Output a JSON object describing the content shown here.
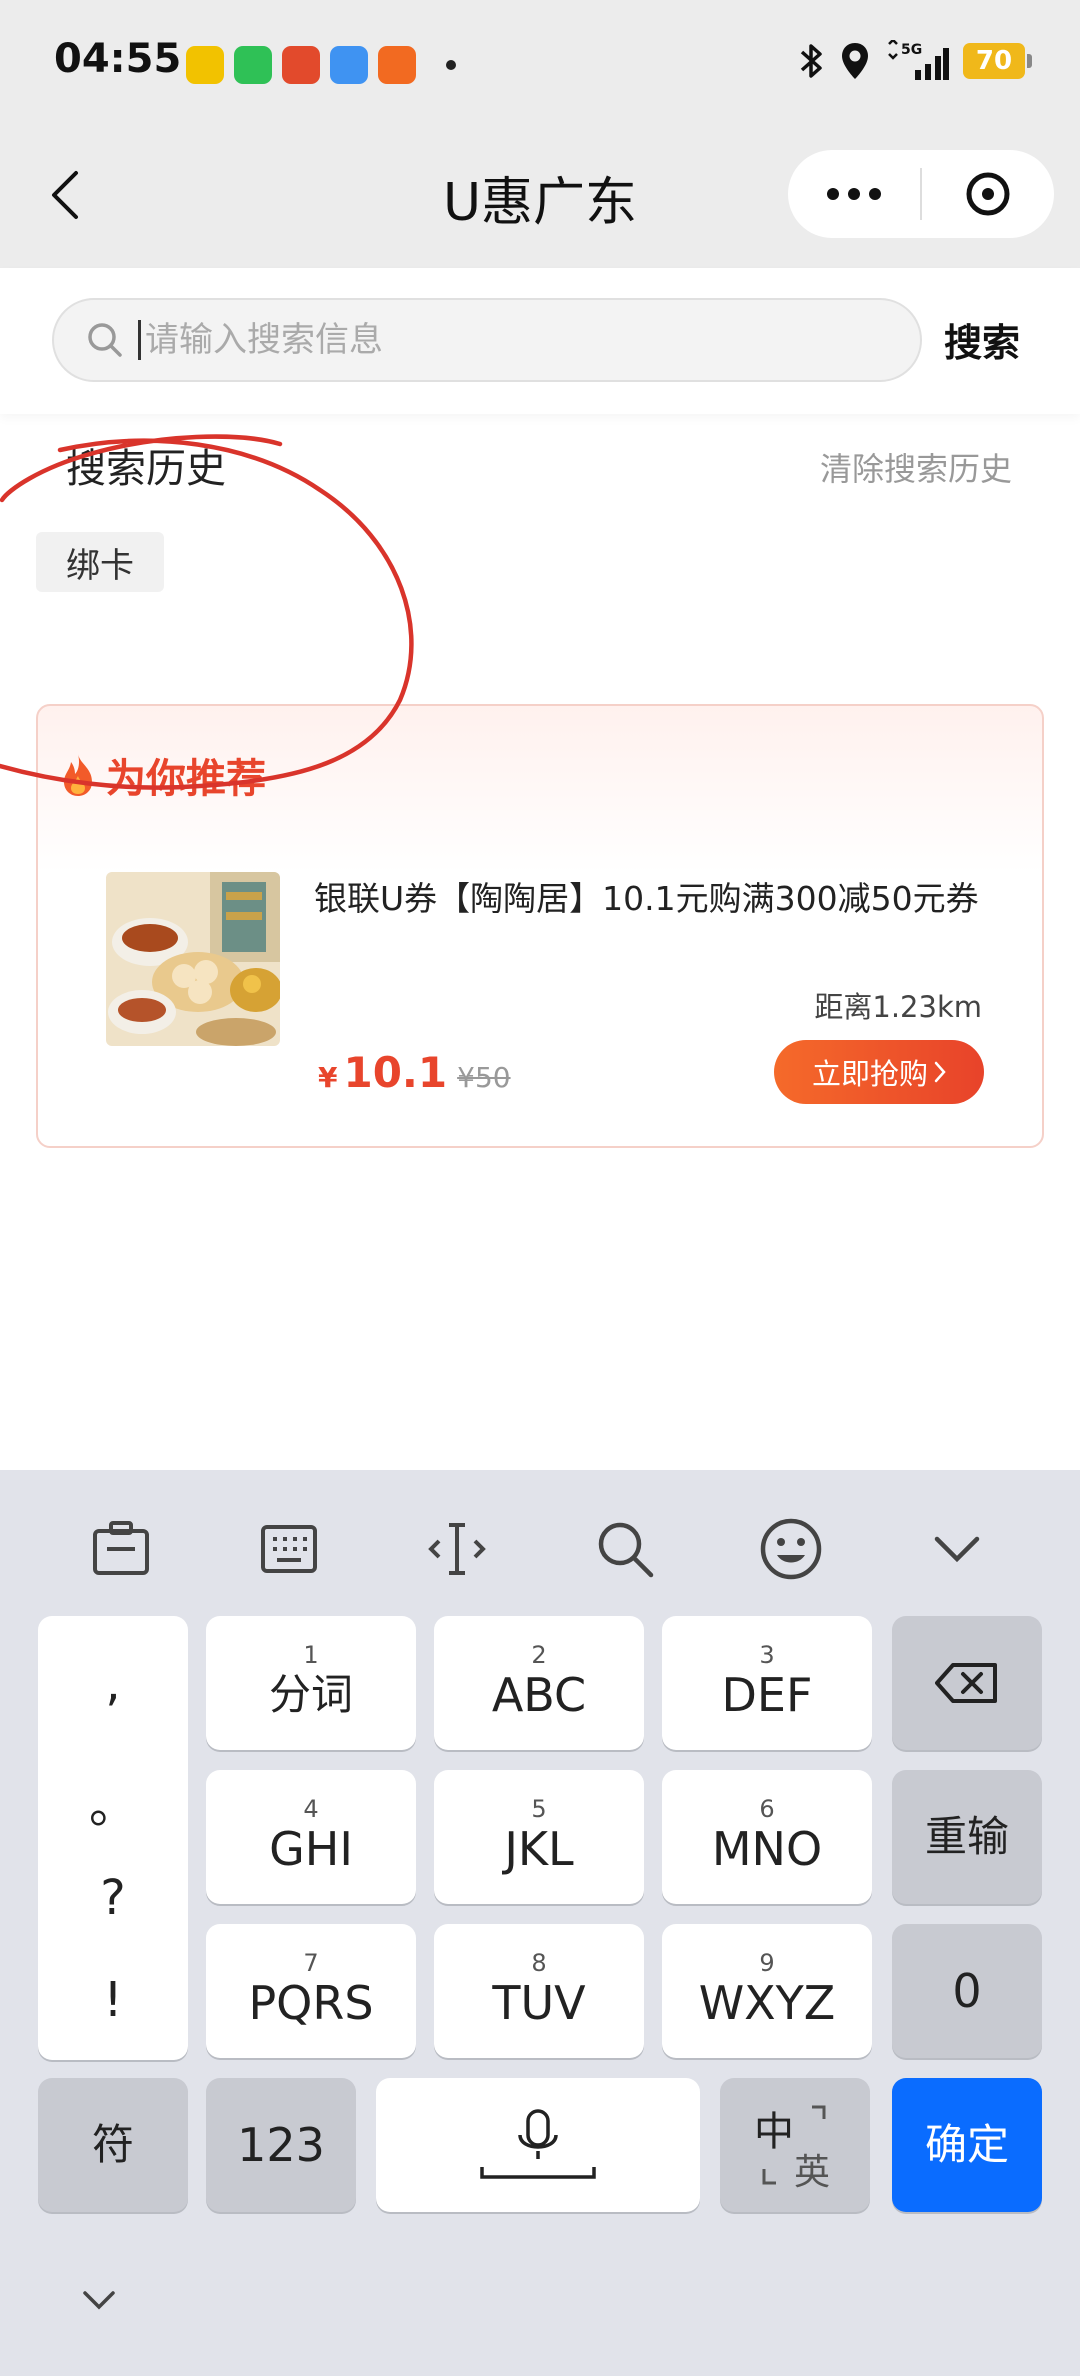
{
  "status": {
    "time": "04:55",
    "battery": "70",
    "network": "5G"
  },
  "nav": {
    "title": "U惠广东"
  },
  "search": {
    "placeholder": "请输入搜索信息",
    "value": "",
    "button_label": "搜索"
  },
  "history": {
    "title": "搜索历史",
    "clear_label": "清除搜索历史",
    "items": [
      {
        "label": "绑卡"
      }
    ]
  },
  "recommend": {
    "title": "为你推荐",
    "items": [
      {
        "name": "银联U券【陶陶居】10.1元购满300减50元券",
        "distance": "距离1.23km",
        "currency": "¥",
        "price": "10.1",
        "original_price": "¥50",
        "buy_label": "立即抢购"
      }
    ]
  },
  "keyboard": {
    "punctuation": [
      ",",
      "。",
      "?",
      "!"
    ],
    "keys": [
      {
        "num": "1",
        "label": "分词"
      },
      {
        "num": "2",
        "label": "ABC"
      },
      {
        "num": "3",
        "label": "DEF"
      },
      {
        "num": "4",
        "label": "GHI"
      },
      {
        "num": "5",
        "label": "JKL"
      },
      {
        "num": "6",
        "label": "MNO"
      },
      {
        "num": "7",
        "label": "PQRS"
      },
      {
        "num": "8",
        "label": "TUV"
      },
      {
        "num": "9",
        "label": "WXYZ"
      }
    ],
    "reinput_label": "重输",
    "zero_label": "0",
    "symbol_label": "符",
    "number_label": "123",
    "lang_cn": "中",
    "lang_en": "英",
    "confirm_label": "确定",
    "confirm_color": "#0a6cff"
  },
  "colors": {
    "accent": "#e8452c",
    "annotation": "#d9342b"
  }
}
